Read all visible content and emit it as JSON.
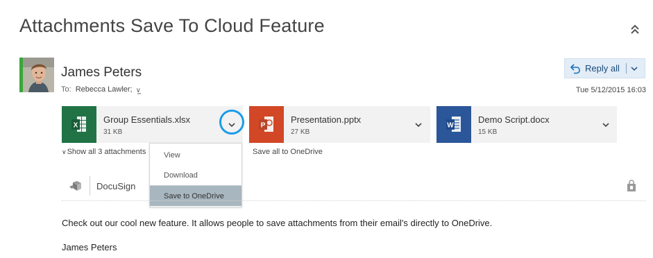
{
  "message": {
    "subject": "Attachments Save To Cloud Feature",
    "sender": "James Peters",
    "to_label": "To:",
    "to_recipients": "Rebecca Lawler;",
    "date": "Tue 5/12/2015 16:03"
  },
  "actions": {
    "reply_all_label": "Reply all"
  },
  "attachments": [
    {
      "name": "Group Essentials.xlsx",
      "size": "31 KB",
      "type": "excel",
      "color": "#217346"
    },
    {
      "name": "Presentation.pptx",
      "size": "27 KB",
      "type": "powerpoint",
      "color": "#d24726"
    },
    {
      "name": "Demo Script.docx",
      "size": "15 KB",
      "type": "word",
      "color": "#2b579a"
    }
  ],
  "attachment_links": {
    "show_all": "Show all 3 attachments",
    "save_all": "Save all to OneDrive"
  },
  "attachment_menu": {
    "items": [
      "View",
      "Download",
      "Save to OneDrive"
    ],
    "selected": "Save to OneDrive"
  },
  "addin": {
    "label": "DocuSign"
  },
  "body": {
    "text": "Check out our cool new feature. It allows people to save attachments from their email's directly to OneDrive.",
    "signature": "James Peters"
  },
  "colors": {
    "accent": "#1a9ce8",
    "reply_bg": "#e2edf7",
    "menu_selected": "#a8b6bf",
    "presence": "#3aa63a"
  },
  "icons": [
    "chevron-double-up-icon",
    "reply-all-icon",
    "chevron-down-icon",
    "excel-icon",
    "powerpoint-icon",
    "word-icon",
    "docusign-icon",
    "store-icon"
  ]
}
